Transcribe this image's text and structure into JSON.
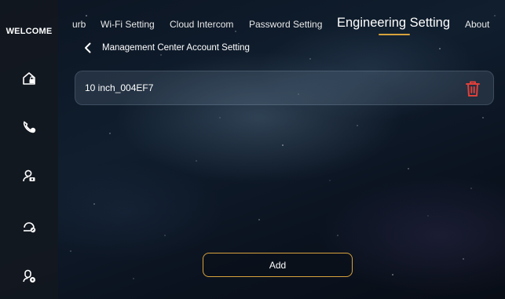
{
  "sidebar": {
    "title": "WELCOME",
    "icons": [
      "home-lock-icon",
      "phone-handset-icon",
      "user-camera-icon",
      "user-edit-icon",
      "user-settings-icon"
    ]
  },
  "tabs": [
    {
      "label": "urb",
      "active": false
    },
    {
      "label": "Wi-Fi Setting",
      "active": false
    },
    {
      "label": "Cloud Intercom",
      "active": false
    },
    {
      "label": "Password Setting",
      "active": false
    },
    {
      "label": "Engineering Setting",
      "active": true
    },
    {
      "label": "About",
      "active": false
    }
  ],
  "page": {
    "subtitle": "Management Center Account Setting"
  },
  "accounts": [
    {
      "name": "10 inch_004EF7"
    }
  ],
  "actions": {
    "add_label": "Add"
  },
  "colors": {
    "accent": "#d8a23c",
    "delete": "#e0403a",
    "sidebar_bg": "#12181f"
  }
}
